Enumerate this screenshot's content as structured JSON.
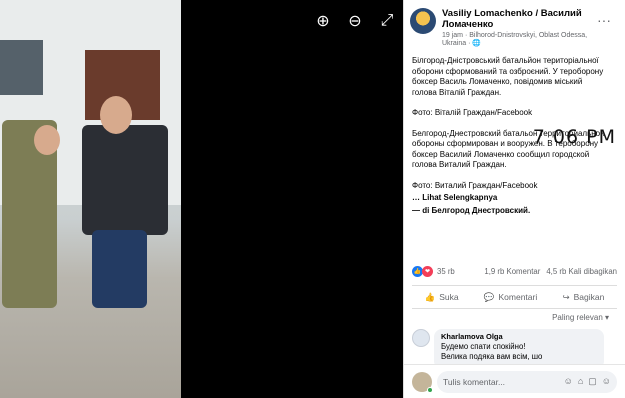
{
  "toolbar": {
    "zoom_in": "zoom-in-icon",
    "zoom_out": "zoom-out-icon",
    "fullscreen": "fullscreen-icon"
  },
  "overlay_time": "7 06 PM",
  "post": {
    "author": "Vasiliy Lomachenko / Василий Ломаченко",
    "meta": "19 jam · Bilhorod-Dnistrovskyi, Oblast Odessa, Ukraina · 🌐",
    "more": "···",
    "para1": "Білгород-Дністровський батальйон територіальної оборони сформований та озброєний. У тероборону боксер Василь Ломаченко, повідомив міський голова Віталій Граждан.",
    "para2": "Фото: Віталій Граждан/Facebook",
    "para3": "Белгород-Днестровский батальон территориальной обороны сформирован и вооружен. В тероборону боксер Василий Ломаченко сообщил городской голова Виталий Граждан.",
    "para4": "Фото: Виталий Граждан/Facebook",
    "see_translation": "… Lihat Selengkapnya",
    "location": "— di Белгород Днестровский."
  },
  "stats": {
    "reactions": "35 rb",
    "comments": "1,9 rb Komentar",
    "shares": "4,5 rb Kali dibagikan"
  },
  "actions": {
    "like": "Suka",
    "comment": "Komentari",
    "share": "Bagikan"
  },
  "sort": "Paling relevan ▾",
  "comment": {
    "name": "Kharlamova Olga",
    "line1": "Будемо спати спокійно!",
    "line2": "Велика подяка вам всім, шо"
  },
  "write": {
    "placeholder": "Tulis komentar..."
  }
}
